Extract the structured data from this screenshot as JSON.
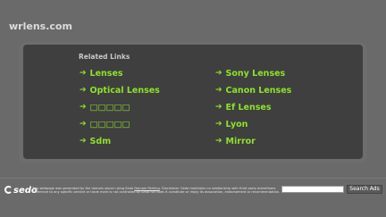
{
  "site": {
    "title": "wrlens.com"
  },
  "links_panel": {
    "heading": "Related Links",
    "left_column": [
      {
        "label": "Lenses"
      },
      {
        "label": "Optical Lenses"
      },
      {
        "label": "□□□□□"
      },
      {
        "label": "□□□□□"
      },
      {
        "label": "Sdm"
      }
    ],
    "right_column": [
      {
        "label": "Sony Lenses"
      },
      {
        "label": "Canon Lenses"
      },
      {
        "label": "Ef Lenses"
      },
      {
        "label": "Lyon"
      },
      {
        "label": "Mirror"
      }
    ],
    "arrow_glyph": "➔"
  },
  "footer": {
    "logo_text": "sedo",
    "disclaimer_part1": "This webpage was generated by the domain owner using Sedo ",
    "disclaimer_link": "Domain Parking",
    "disclaimer_part2": ". Disclaimer: Sedo maintains no relationship with third party advertisers. Reference to any specific service or trade mark is not controlled by Sedo nor does it constitute or imply its association, endorsement or recommendation.",
    "search_placeholder": "",
    "search_button_label": "Search Ads"
  },
  "colors": {
    "background": "#6a6a6a",
    "panel": "#3f3f3f",
    "link": "#8fe12a",
    "heading": "#c9c9c9"
  }
}
